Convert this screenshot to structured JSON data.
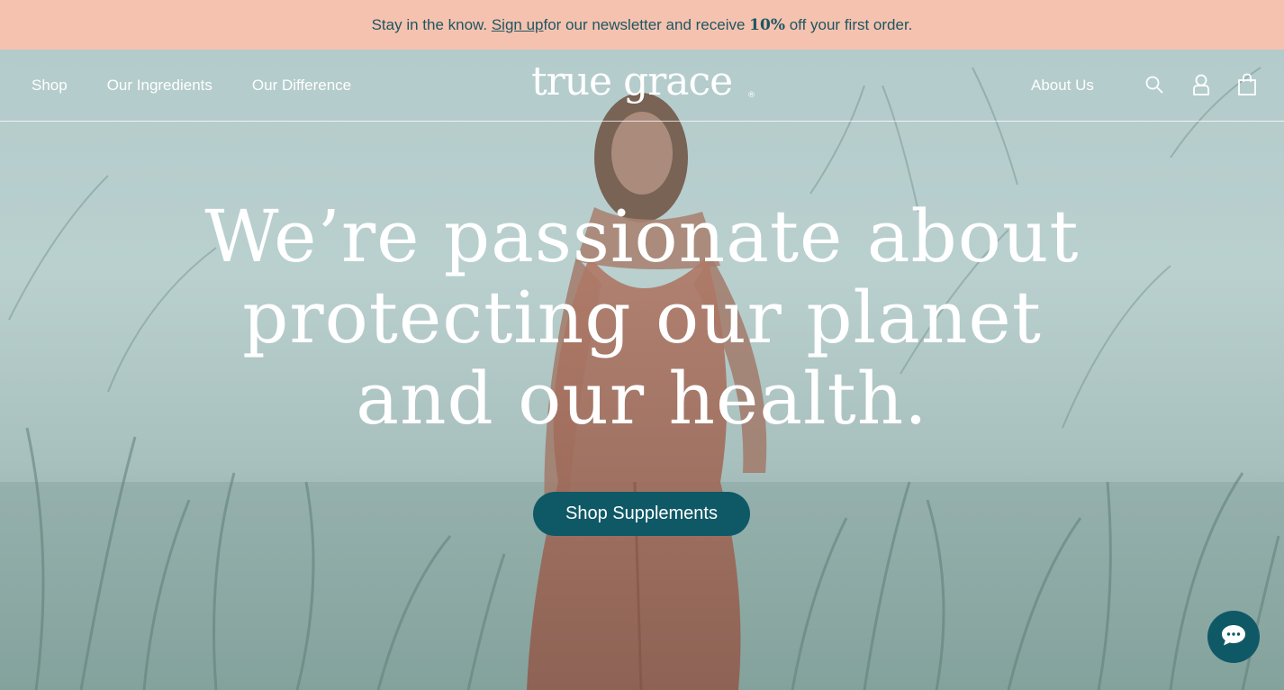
{
  "announcement": {
    "prefix": "Stay in the know. ",
    "link": "Sign up ",
    "middle": "for our newsletter and receive ",
    "discount": "10%",
    "suffix": " off your first order."
  },
  "nav": {
    "left": [
      "Shop",
      "Our Ingredients",
      "Our Difference"
    ],
    "right": "About Us"
  },
  "logo": {
    "text": "true grace",
    "reg": "®"
  },
  "icons": [
    "search-icon",
    "account-icon",
    "cart-icon",
    "chat-icon"
  ],
  "hero": {
    "headline": [
      "We’re passionate about",
      "protecting our planet",
      "and our health."
    ],
    "cta": "Shop Supplements"
  },
  "colors": {
    "announcement_bg": "#f6c2b0",
    "brand_teal": "#0f5967",
    "text_teal": "#1d5661"
  }
}
